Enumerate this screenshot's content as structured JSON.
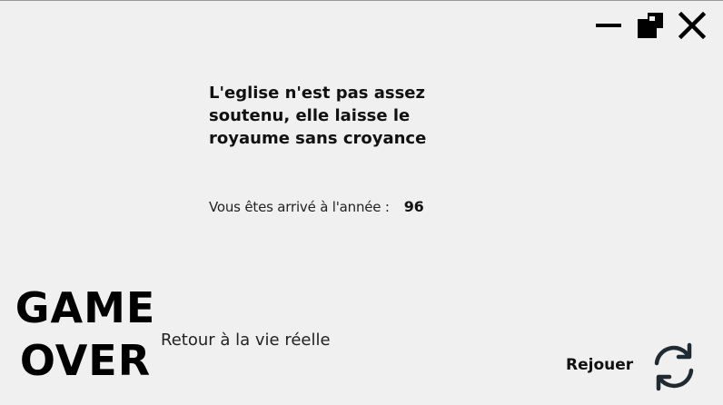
{
  "window": {
    "minimize_icon": "minimize-icon",
    "restore_icon": "restore-icon",
    "close_icon": "close-icon"
  },
  "message": {
    "text": "L'eglise n'est pas assez soutenu, elle laisse le royaume sans croyance"
  },
  "year": {
    "label": "Vous êtes arrivé à l'année :",
    "value": "96"
  },
  "game_over": {
    "line1": "GAME",
    "line2": "OVER"
  },
  "actions": {
    "return_label": "Retour à la vie réelle",
    "replay_label": "Rejouer",
    "replay_icon": "refresh-icon"
  },
  "colors": {
    "background": "#f0f0f0",
    "text": "#111111",
    "icon": "#1f2a33"
  }
}
